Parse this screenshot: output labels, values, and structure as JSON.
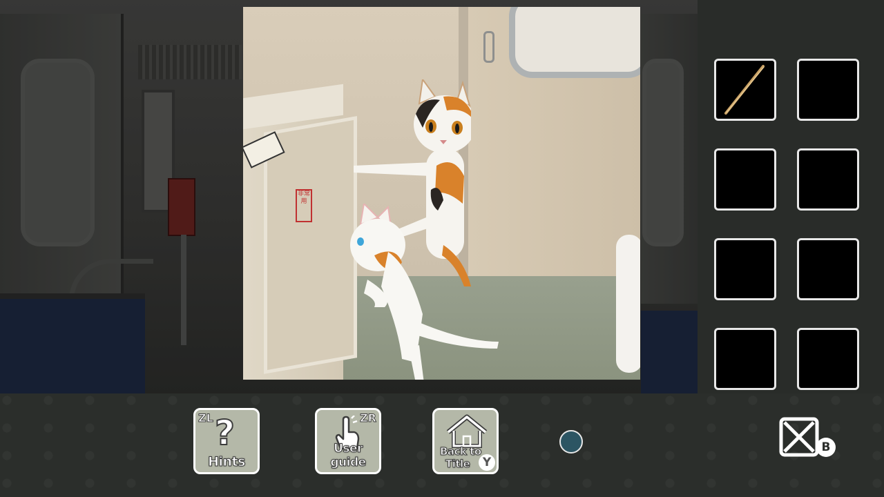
{
  "panel": {
    "sign_text": "非常用"
  },
  "inventory": {
    "slots": [
      {
        "item": "wooden-stick"
      },
      {
        "item": ""
      },
      {
        "item": ""
      },
      {
        "item": ""
      },
      {
        "item": ""
      },
      {
        "item": ""
      },
      {
        "item": ""
      },
      {
        "item": ""
      }
    ]
  },
  "toolbar": {
    "hints": {
      "label": "Hints",
      "shortcut": "ZL",
      "icon": "question-mark-icon"
    },
    "user_guide": {
      "label": "User guide",
      "shortcut": "ZR",
      "icon": "pointing-hand-icon"
    },
    "back_to_title": {
      "label_line1": "Back to",
      "label_line2": "Title",
      "shortcut": "Y",
      "icon": "house-icon"
    },
    "close": {
      "shortcut": "B",
      "icon": "close-box-icon"
    }
  },
  "colors": {
    "button_fill": "#b4b8a8",
    "dot_fill": "#2c5563",
    "background": "#2b2e2b"
  }
}
